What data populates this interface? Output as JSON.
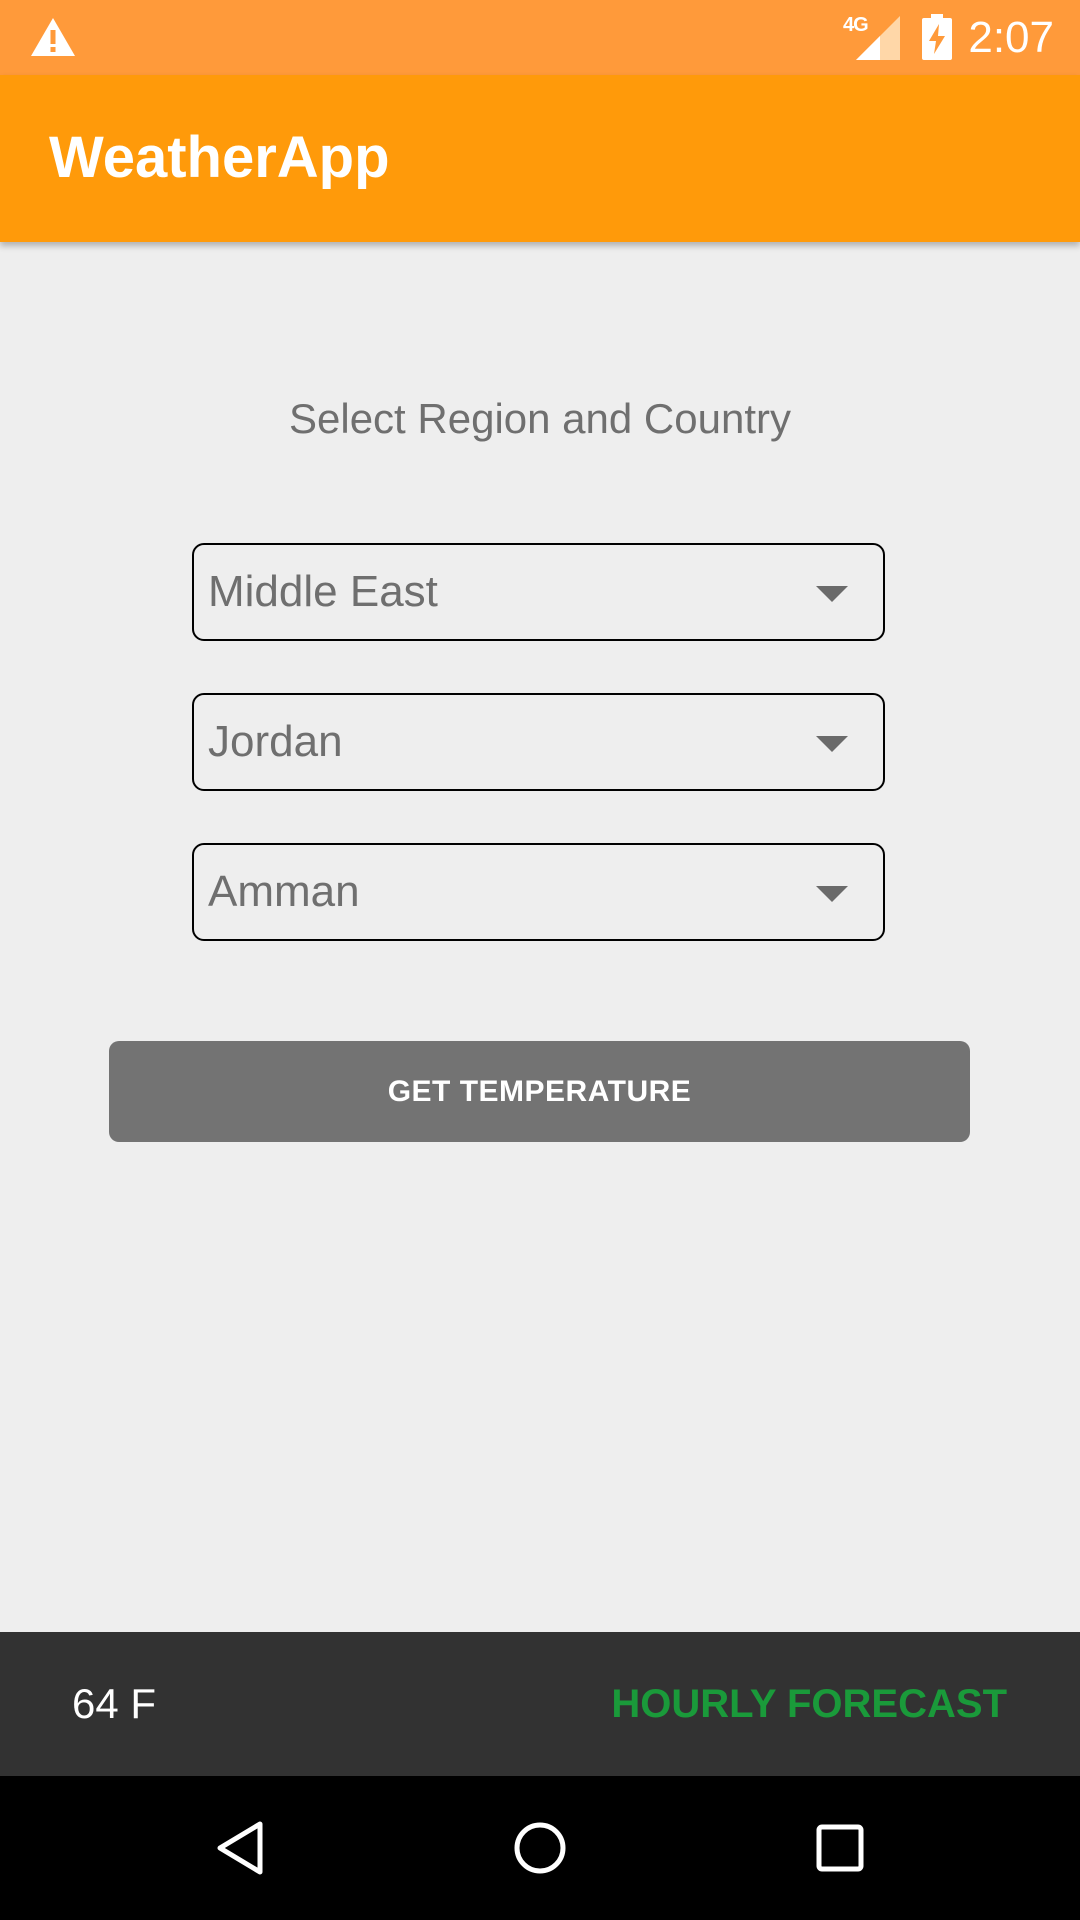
{
  "status_bar": {
    "network": "4G",
    "time": "2:07",
    "icons": [
      "warning-icon",
      "signal-icon",
      "battery-charging-icon"
    ]
  },
  "app_bar": {
    "title": "WeatherApp"
  },
  "main": {
    "instruction": "Select Region and Country",
    "region_value": "Middle East",
    "country_value": "Jordan",
    "city_value": "Amman",
    "get_temperature_label": "GET TEMPERATURE"
  },
  "bottom_bar": {
    "temperature": "64 F",
    "hourly_forecast_label": "HOURLY FORECAST"
  },
  "nav_bar": {
    "icons": [
      "back-icon",
      "home-icon",
      "recents-icon"
    ]
  },
  "colors": {
    "status_bar": "#ff9a3a",
    "app_bar": "#ff9a0a",
    "button": "#737373",
    "bottom_bar": "#323232",
    "forecast_text": "#1a9a3a"
  }
}
